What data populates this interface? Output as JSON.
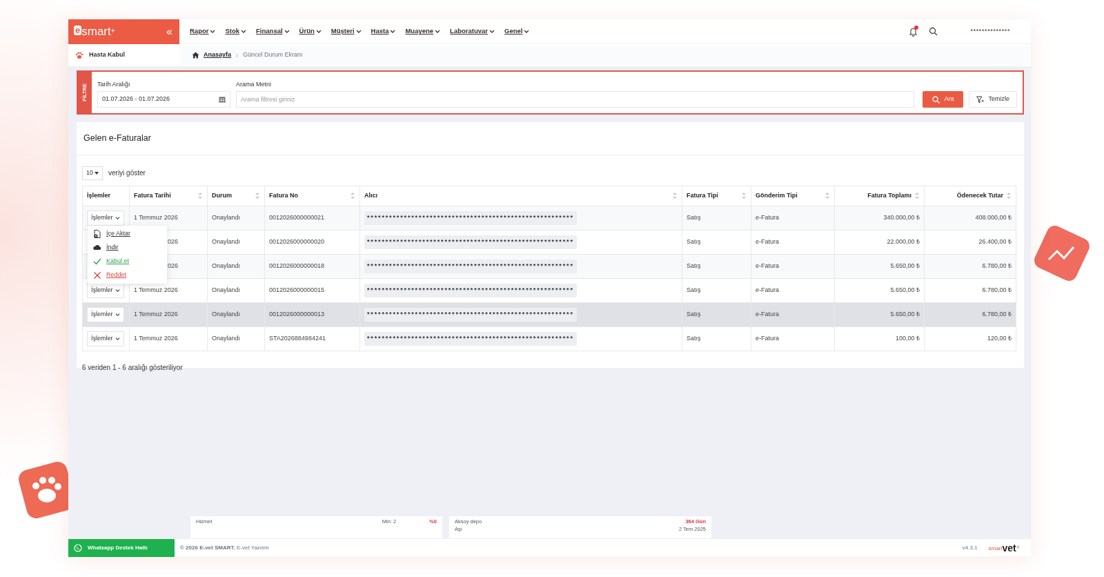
{
  "header": {
    "logo": {
      "mark": "e",
      "name": "smart",
      "plus": "+"
    },
    "collapse": "«",
    "nav": [
      "Rapor",
      "Stok",
      "Finansal",
      "Ürün",
      "Müşteri",
      "Hasta",
      "Muayene",
      "Laboratuvar",
      "Genel"
    ],
    "has_unread": true,
    "user": "**************"
  },
  "sidebar": {
    "items": [
      {
        "label": "Hasta Kabul",
        "selected": false
      }
    ]
  },
  "breadcrumb": [
    "Anasayfa",
    "Güncel Durum Ekranı"
  ],
  "filter": {
    "label": "FİLTRE",
    "date_label": "Tarih Aralığı",
    "date_value": "01.07.2026 - 01.07.2026",
    "search_label": "Arama Metni",
    "placeholder": "Arama filtresi giriniz",
    "search_button": "Ara",
    "clear_button": "Temizle"
  },
  "card": {
    "title": "Gelen e-Faturalar",
    "page_length": "10",
    "length_label": "veriyi göster",
    "columns": [
      {
        "label": "İşlemler",
        "sortable": false,
        "kind": "text"
      },
      {
        "label": "Fatura Tarihi",
        "sortable": true,
        "kind": "text"
      },
      {
        "label": "Durum",
        "sortable": true,
        "kind": "text"
      },
      {
        "label": "Fatura No",
        "sortable": true,
        "kind": "text"
      },
      {
        "label": "Alıcı",
        "sortable": true,
        "kind": "text"
      },
      {
        "label": "Fatura Tipi",
        "sortable": true,
        "kind": "text"
      },
      {
        "label": "Gönderim Tipi",
        "sortable": true,
        "kind": "text"
      },
      {
        "label": "Fatura Toplamı",
        "sortable": true,
        "kind": "amount"
      },
      {
        "label": "Ödenecek Tutar",
        "sortable": true,
        "kind": "amount"
      }
    ],
    "rows": [
      {
        "actions": "İşlemler",
        "date": "1 Temmuz 2026",
        "status": "Onaylandı",
        "no": "0012026000000021",
        "recipient": "********************************************************",
        "type": "Satış",
        "send": "e-Fatura",
        "total": "340.000,00 ₺",
        "due": "408.000,00 ₺",
        "highlighted": false
      },
      {
        "date": "026",
        "status": "Onaylandı",
        "no": "0012026000000020",
        "recipient": "********************************************************",
        "type": "Satış",
        "send": "e-Fatura",
        "total": "22.000,00 ₺",
        "due": "26.400,00 ₺",
        "highlighted": false
      },
      {
        "date": "026",
        "status": "Onaylandı",
        "no": "0012026000000018",
        "recipient": "********************************************************",
        "type": "Satış",
        "send": "e-Fatura",
        "total": "5.650,00 ₺",
        "due": "6.780,00 ₺",
        "highlighted": false
      },
      {
        "actions": "İşlemler",
        "date": "1 Temmuz 2026",
        "status": "Onaylandı",
        "no": "0012026000000015",
        "recipient": "********************************************************",
        "type": "Satış",
        "send": "e-Fatura",
        "total": "5.650,00 ₺",
        "due": "6.780,00 ₺",
        "highlighted": false
      },
      {
        "actions": "İşlemler",
        "date": "1 Temmuz 2026",
        "status": "Onaylandı",
        "no": "0012026000000013",
        "recipient": "********************************************************",
        "type": "Satış",
        "send": "e-Fatura",
        "total": "5.650,00 ₺",
        "due": "6.780,00 ₺",
        "highlighted": true
      },
      {
        "actions": "İşlemler",
        "date": "1 Temmuz 2026",
        "status": "Onaylandı",
        "no": "STA2026884984241",
        "recipient": "********************************************************",
        "type": "Satış",
        "send": "e-Fatura",
        "total": "100,00 ₺",
        "due": "120,00 ₺",
        "highlighted": false
      }
    ],
    "menu": [
      {
        "label": "İçe Aktar",
        "kind": "import"
      },
      {
        "label": "İndir",
        "kind": "download"
      },
      {
        "label": "Kabul et",
        "kind": "accept"
      },
      {
        "label": "Reddet",
        "kind": "reject"
      }
    ],
    "info": "6 veriden 1 - 6 aralığı gösteriliyor"
  },
  "behind": [
    {
      "a": "Hizmet",
      "b": "Min: 2",
      "c": "%0"
    },
    {
      "a": "Aksoy depo",
      "b": "Aşı",
      "c": "364 Gün",
      "d": "2 Tem 2025"
    }
  ],
  "footer": {
    "whatsapp": "Whatsapp Destek Hattı",
    "copyright": "**© 2026 E-vet SMART.** E-vet Yazılım",
    "version": "v4.3.1",
    "brand": {
      "small": "smart",
      "big": "vet",
      "plus": "+"
    }
  }
}
